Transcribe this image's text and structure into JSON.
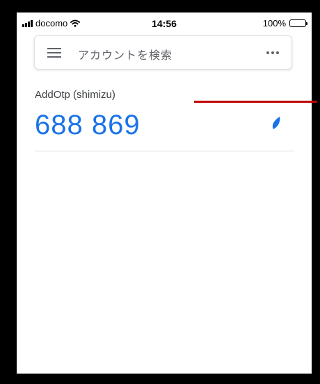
{
  "status_bar": {
    "carrier": "docomo",
    "time": "14:56",
    "battery": "100%"
  },
  "search": {
    "placeholder": "アカウントを検索"
  },
  "account": {
    "name": "AddOtp (shimizu)",
    "code": "688 869"
  },
  "colors": {
    "code": "#1a73e8",
    "annotation_line": "#c00000"
  },
  "icons": [
    "menu-icon",
    "more-icon",
    "timer-icon",
    "wifi-icon",
    "signal-icon",
    "battery-icon"
  ]
}
